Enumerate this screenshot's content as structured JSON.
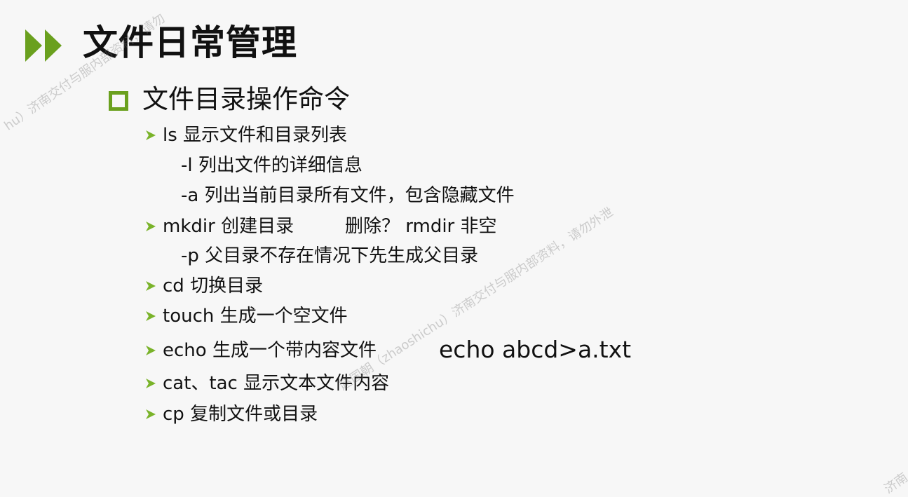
{
  "slide": {
    "title": "文件日常管理",
    "section": "文件目录操作命令",
    "items": [
      {
        "label": "ls 显示文件和目录列表"
      },
      {
        "label": "mkdir 创建目录",
        "extra": "删除？ rmdir  非空"
      },
      {
        "label": "cd 切换目录"
      },
      {
        "label": "touch 生成一个空文件"
      },
      {
        "label": "echo 生成一个带内容文件",
        "example": "echo abcd>a.txt"
      },
      {
        "label": "cat、tac 显示文本文件内容"
      },
      {
        "label": "cp 复制文件或目录"
      }
    ],
    "subitems": [
      {
        "label": "-l 列出文件的详细信息"
      },
      {
        "label": "-a 列出当前目录所有文件，包含隐藏文件"
      },
      {
        "label": "-p 父目录不存在情况下先生成父目录"
      }
    ]
  },
  "watermarks": [
    "hu）济南交付与服内部资料，请勿",
    "赵国朝（zhaoshichu）济南交付与服内部资料，请勿外泄",
    "济南"
  ],
  "colors": {
    "accent": "#6aa01e",
    "bullet": "#7ab32a",
    "background": "#f7f7f7"
  },
  "icons": {
    "title_marker": "double-triangle-right-icon",
    "section_marker": "hollow-square-icon",
    "item_marker": "arrow-bullet-icon"
  }
}
